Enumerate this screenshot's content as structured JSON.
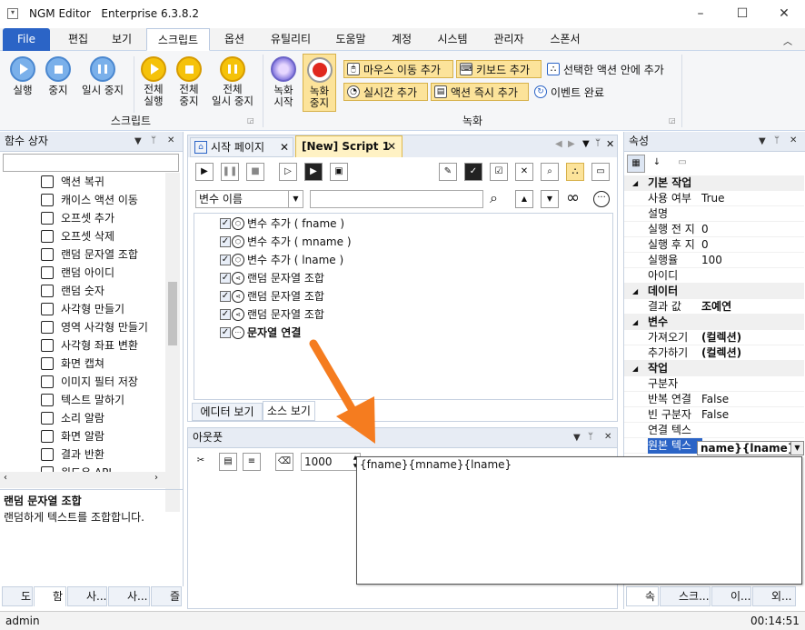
{
  "app": {
    "name": "NGM Editor",
    "edition": "Enterprise 6.3.8.2"
  },
  "window_controls": {
    "minimize": "–",
    "maximize": "☐",
    "close": "✕"
  },
  "menu": [
    "File",
    "편집",
    "보기",
    "스크립트",
    "옵션",
    "유틸리티",
    "도움말",
    "계정",
    "시스템",
    "관리자",
    "스폰서"
  ],
  "menu_active_index": 3,
  "ribbon": {
    "script_group": {
      "label": "스크립트",
      "buttons": [
        "실행",
        "중지",
        "일시 중지"
      ],
      "all_buttons": [
        [
          "전체",
          "실행"
        ],
        [
          "전체",
          "중지"
        ],
        [
          "전체",
          "일시 중지"
        ]
      ]
    },
    "record_group": {
      "label": "녹화",
      "record_start": [
        "녹화",
        "시작"
      ],
      "record_stop": [
        "녹화",
        "중지"
      ],
      "small_buttons": [
        "마우스 이동 추가",
        "키보드 추가",
        "선택한 액션 안에 추가",
        "실시간 추가",
        "액션 즉시 추가",
        "이벤트 완료"
      ]
    }
  },
  "left_panel": {
    "title": "함수 상자",
    "items": [
      {
        "label": "액션 복귀",
        "icon": "undo-icon"
      },
      {
        "label": "캐이스 액션 이동",
        "icon": "branch-icon"
      },
      {
        "label": "오프셋 추가",
        "icon": "offset-icon"
      },
      {
        "label": "오프셋 삭제",
        "icon": "offset-delete-icon"
      },
      {
        "label": "랜덤 문자열 조합",
        "icon": "share-icon"
      },
      {
        "label": "랜덤 아이디",
        "icon": "share-icon"
      },
      {
        "label": "랜덤 숫자",
        "icon": "share-icon"
      },
      {
        "label": "사각형 만들기",
        "icon": "rect-icon"
      },
      {
        "label": "영역 사각형 만들기",
        "icon": "area-icon"
      },
      {
        "label": "사각형 좌표 변환",
        "icon": "coord-icon"
      },
      {
        "label": "화면 캡쳐",
        "icon": "camera-icon"
      },
      {
        "label": "이미지 필터 저장",
        "icon": "filter-icon"
      },
      {
        "label": "텍스트 말하기",
        "icon": "wave-icon"
      },
      {
        "label": "소리 알람",
        "icon": "wave-icon"
      },
      {
        "label": "화면 알람",
        "icon": "monitor-icon"
      },
      {
        "label": "결과 반환",
        "icon": "return-icon"
      },
      {
        "label": "윈도우 API",
        "icon": "api-icon"
      }
    ],
    "description_title": "랜덤 문자열 조합",
    "description": "랜덤하게 텍스트를 조합합니다.",
    "bottom_tabs": [
      "도",
      "함",
      "사...",
      "사...",
      "즐"
    ]
  },
  "editor": {
    "tabs": [
      "시작 페이지",
      "[New] Script 1"
    ],
    "active_tab": 1,
    "variable_select": "변수 이름",
    "tree": [
      {
        "label": "변수 추가 ( fname )",
        "bold": false
      },
      {
        "label": "변수 추가 ( mname )",
        "bold": false
      },
      {
        "label": "변수 추가 ( lname )",
        "bold": false
      },
      {
        "label": "랜덤 문자열 조합",
        "bold": false
      },
      {
        "label": "랜덤 문자열 조합",
        "bold": false
      },
      {
        "label": "랜덤 문자열 조합",
        "bold": false
      },
      {
        "label": "문자열 연결",
        "bold": true
      }
    ],
    "view_tabs": [
      "에디터 보기",
      "소스 보기"
    ]
  },
  "output": {
    "title": "아웃풋",
    "count_value": "1000"
  },
  "properties": {
    "title": "속성",
    "categories": [
      {
        "name": "기본 작업",
        "rows": [
          [
            "사용 여부",
            "True"
          ],
          [
            "설명",
            ""
          ],
          [
            "실행 전 지",
            "0"
          ],
          [
            "실행 후 지",
            "0"
          ],
          [
            "실행율",
            "100"
          ],
          [
            "아이디",
            ""
          ]
        ]
      },
      {
        "name": "데이터",
        "rows": [
          [
            "결과 값",
            "조예연"
          ]
        ]
      },
      {
        "name": "변수",
        "rows": [
          [
            "가져오기",
            "(컬렉션)"
          ],
          [
            "추가하기",
            "(컬렉션)"
          ]
        ]
      },
      {
        "name": "작업",
        "rows": [
          [
            "구분자",
            ""
          ],
          [
            "반복 연결",
            "False"
          ],
          [
            "빈 구분자",
            "False"
          ],
          [
            "연결 텍스",
            ""
          ],
          [
            "원본 텍스",
            "name}{lname}"
          ]
        ]
      }
    ],
    "bottom_tabs": [
      "속",
      "스크...",
      "이...",
      "외..."
    ]
  },
  "popup_text": "{fname}{mname}{lname}",
  "status": {
    "user": "admin",
    "time": "00:14:51"
  },
  "colors": {
    "accent": "#2b64c6",
    "arrow": "#f57c1f"
  }
}
